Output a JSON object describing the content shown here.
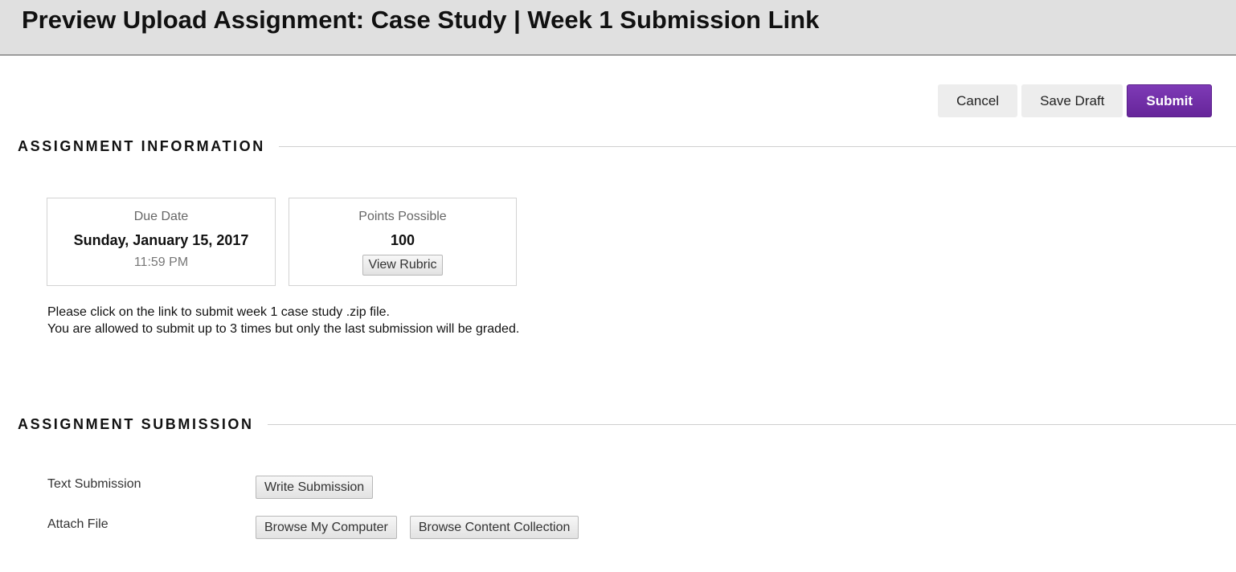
{
  "header": {
    "title": "Preview Upload Assignment: Case Study | Week 1 Submission Link"
  },
  "actions": {
    "cancel_label": "Cancel",
    "save_draft_label": "Save Draft",
    "submit_label": "Submit",
    "submit_color": "#6f2da8"
  },
  "assignment_info": {
    "heading": "ASSIGNMENT INFORMATION",
    "due": {
      "label": "Due Date",
      "date": "Sunday, January 15, 2017",
      "time": "11:59 PM"
    },
    "points": {
      "label": "Points Possible",
      "value": "100",
      "rubric_label": "View Rubric"
    },
    "instructions": [
      "Please click on the link to submit week 1 case study .zip file.",
      "You are allowed to submit up to 3 times but only the last submission will be graded."
    ]
  },
  "assignment_submission": {
    "heading": "ASSIGNMENT SUBMISSION",
    "text_submission": {
      "label": "Text Submission",
      "button": "Write Submission"
    },
    "attach_file": {
      "label": "Attach File",
      "browse_computer": "Browse My Computer",
      "browse_collection": "Browse Content Collection"
    }
  }
}
